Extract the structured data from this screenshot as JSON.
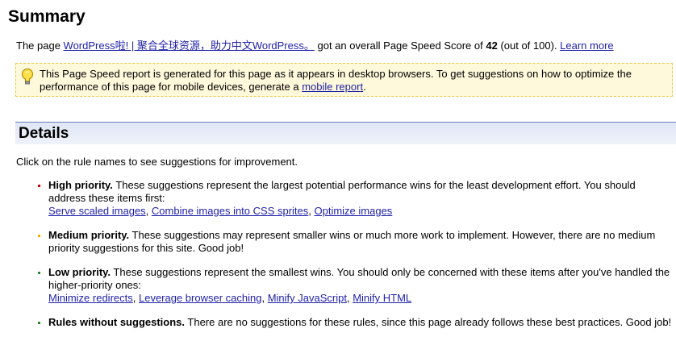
{
  "summary": {
    "title": "Summary",
    "prefix": "The page ",
    "page_link": "WordPress啦! | 聚合全球资源，助力中文WordPress。",
    "middle": " got an overall Page Speed Score of ",
    "score": "42",
    "suffix": " (out of 100). ",
    "learn_more": "Learn more"
  },
  "notice": {
    "icon": "lightbulb-icon",
    "text": "This Page Speed report is generated for this page as it appears in desktop browsers. To get suggestions on how to optimize the performance of this page for mobile devices, generate a ",
    "link": "mobile report",
    "end": "."
  },
  "details": {
    "title": "Details",
    "intro": "Click on the rule names to see suggestions for improvement."
  },
  "rules": [
    {
      "color": "#cc0000",
      "label": "High priority.",
      "text": " These suggestions represent the largest potential performance wins for the least development effort. You should address these items first:",
      "links": [
        "Serve scaled images",
        "Combine images into CSS sprites",
        "Optimize images"
      ]
    },
    {
      "color": "#f0b400",
      "label": "Medium priority.",
      "text": " These suggestions may represent smaller wins or much more work to implement. However, there are no medium priority suggestions for this site. Good job!",
      "links": []
    },
    {
      "color": "#2a8a2a",
      "label": "Low priority.",
      "text": " These suggestions represent the smallest wins. You should only be concerned with these items after you've handled the higher-priority ones:",
      "links": [
        "Minimize redirects",
        "Leverage browser caching",
        "Minify JavaScript",
        "Minify HTML"
      ]
    },
    {
      "color": "#2a8a2a",
      "label": "Rules without suggestions.",
      "text": " There are no suggestions for these rules, since this page already follows these best practices. Good job!",
      "links": []
    }
  ],
  "link_separator": ", "
}
